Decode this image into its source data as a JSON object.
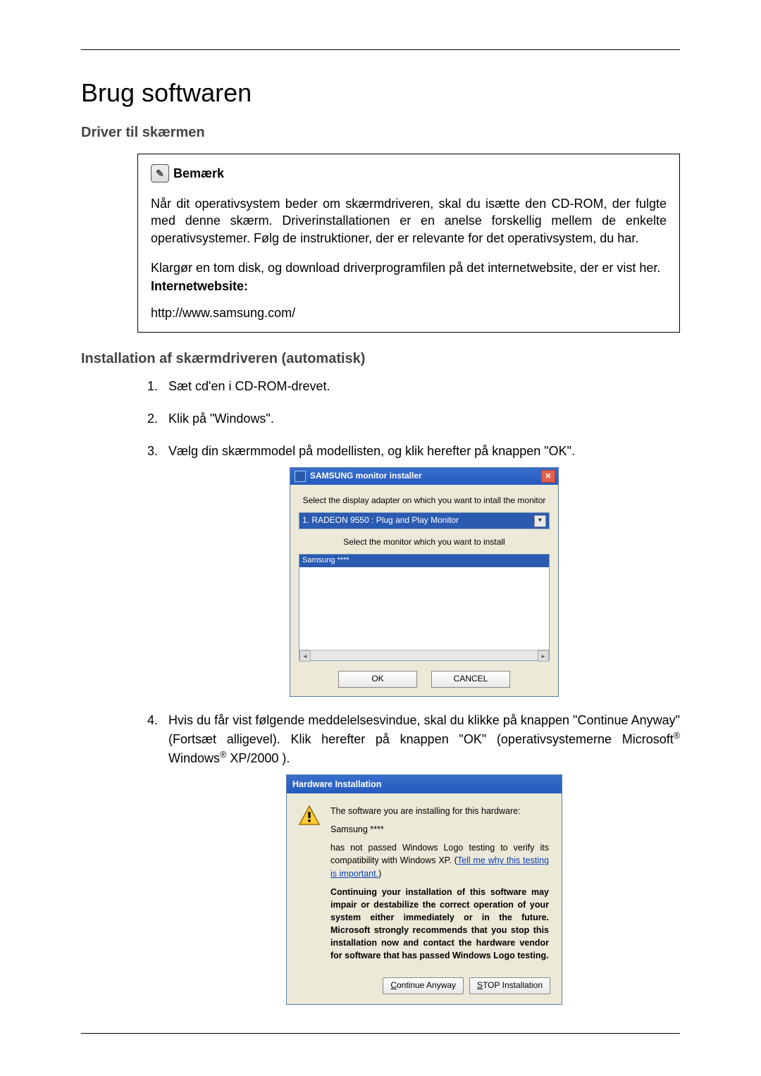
{
  "page_title": "Brug softwaren",
  "section_driver_title": "Driver til skærmen",
  "note": {
    "label": "Bemærk",
    "p1": "Når dit operativsystem beder om skærmdriveren, skal du isætte den CD-ROM, der fulgte med denne skærm. Driverinstallationen er en anelse forskellig mellem de enkelte operativsystemer. Følg de instruktioner, der er relevante for det operativsystem, du har.",
    "p2": "Klargør en tom disk, og download driverprogramfilen på det internetwebsite, der er vist her.",
    "website_label": "Internetwebsite:",
    "url": "http://www.samsung.com/"
  },
  "subsection_install_title": "Installation af skærmdriveren (automatisk)",
  "steps": {
    "s1": "Sæt cd'en i CD-ROM-drevet.",
    "s2": "Klik på \"Windows\".",
    "s3": "Vælg din skærmmodel på modellisten, og klik herefter på knappen \"OK\".",
    "s4_a": "Hvis du får vist følgende meddelelsesvindue, skal du klikke på knappen \"Continue Anyway\" (Fortsæt alligevel). Klik herefter på knappen \"OK\" (operativsystemerne Microsoft",
    "s4_b": " Windows",
    "s4_c": " XP/2000 )."
  },
  "dlg1": {
    "title": "SAMSUNG monitor installer",
    "label_adapter": "Select the display adapter on which you want to intall the monitor",
    "adapter_value": "1. RADEON 9550 : Plug and Play Monitor",
    "label_monitor": "Select the monitor which you want to install",
    "monitor_value": "Samsung ****",
    "ok": "OK",
    "cancel": "CANCEL"
  },
  "dlg2": {
    "title": "Hardware Installation",
    "line1": "The software you are installing for this hardware:",
    "line2": "Samsung ****",
    "line3a": "has not passed Windows Logo testing to verify its compatibility with Windows XP. (",
    "link": "Tell me why this testing is important.",
    "line3b": ")",
    "bold": "Continuing your installation of this software may impair or destabilize the correct operation of your system either immediately or in the future. Microsoft strongly recommends that you stop this installation now and contact the hardware vendor for software that has passed Windows Logo testing.",
    "continue": "Continue Anyway",
    "stop": "STOP Installation"
  }
}
